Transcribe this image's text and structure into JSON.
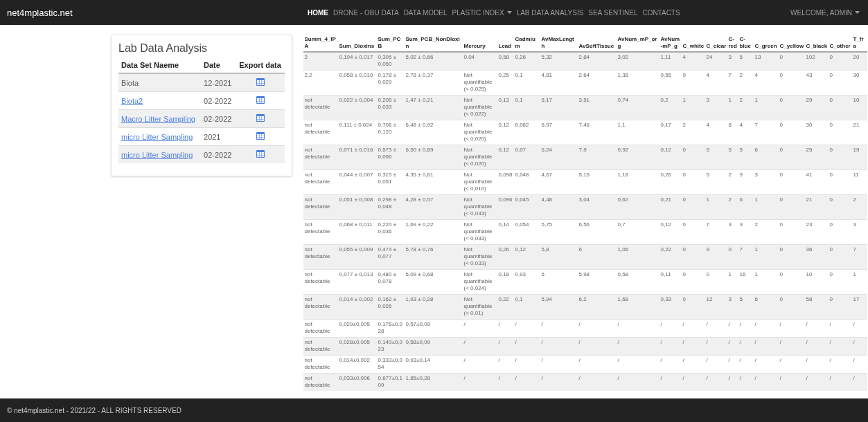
{
  "navbar": {
    "brand": "net4mplastic.net",
    "items": [
      {
        "label": "HOME",
        "selected": true,
        "dropdown": false
      },
      {
        "label": "DRONE - OBU DATA",
        "selected": false,
        "dropdown": false
      },
      {
        "label": "DATA MODEL",
        "selected": false,
        "dropdown": false
      },
      {
        "label": "PLASTIC INDEX",
        "selected": false,
        "dropdown": true
      },
      {
        "label": "LAB DATA ANALYSIS",
        "selected": false,
        "dropdown": false
      },
      {
        "label": "SEA SENTINEL",
        "selected": false,
        "dropdown": false
      },
      {
        "label": "CONTACTS",
        "selected": false,
        "dropdown": false
      }
    ],
    "user_menu": {
      "label": "WELCOME, ADMIN",
      "dropdown": true
    }
  },
  "datasets_panel": {
    "title": "Lab Data Analysis",
    "columns": [
      "Data Set Naeme",
      "Date",
      "Export data"
    ],
    "rows": [
      {
        "name": "Biota",
        "link": false,
        "date": "12-2021"
      },
      {
        "name": "Biota2",
        "link": true,
        "date": "02-2022"
      },
      {
        "name": "Macro Litter Sampling",
        "link": true,
        "date": "02-2022"
      },
      {
        "name": "micro Litter Sampling",
        "link": true,
        "date": "2021"
      },
      {
        "name": "micro Litter Sampling",
        "link": true,
        "date": "02-2022"
      }
    ]
  },
  "data_table": {
    "columns": [
      "Summ_4_IPA",
      "Sum_Dioxins",
      "Sum_PCB",
      "Sum_PCB_NonDioxin",
      "Mercury",
      "Lead",
      "Cadmium",
      "AvMaxLength",
      "AvSoftTissue",
      "AvNum_mP_org",
      "AvNum-mP_g",
      "C_white",
      "C_clear",
      "C-red",
      "C-blue",
      "C_green",
      "C_yellow",
      "C_black",
      "C_other",
      "T_fra"
    ],
    "rows": [
      [
        "2",
        "0,104 ± 0,017",
        "0,305 ± 0,050",
        "5,02 ± 0,66",
        "0,04",
        "0,58",
        "0,26",
        "5,32",
        "2,84",
        "3,02",
        "1,11",
        "4",
        "24",
        "3",
        "5",
        "13",
        "0",
        "102",
        "0",
        "20"
      ],
      [
        "2,2",
        "0,058 ± 0,010",
        "0,178 ± 0,029",
        "2,78 ± 0,37",
        "Not quantifiable (< 0,025)",
        "0,25",
        "0,1",
        "4,81",
        "2,64",
        "1,38",
        "0,55",
        "9",
        "4",
        "7",
        "2",
        "4",
        "0",
        "43",
        "0",
        "30"
      ],
      [
        "not detectable",
        "0,022 ± 0,004",
        "0,205 ± 0,033",
        "1,47 ± 0,21",
        "Not quantifiable (< 0,022)",
        "0,13",
        "0,1",
        "5,17",
        "3,51",
        "0,74",
        "0,2",
        "1",
        "3",
        "1",
        "2",
        "1",
        "0",
        "29",
        "0",
        "10"
      ],
      [
        "not detectable",
        "0,111 ± 0,024",
        "0,706 ± 0,120",
        "6,48 ± 0,92",
        "Not quantifiable (< 0,020)",
        "0,12",
        "0,062",
        "6,97",
        "7,46",
        "1,1",
        "0,17",
        "2",
        "4",
        "8",
        "4",
        "7",
        "0",
        "30",
        "0",
        "21"
      ],
      [
        "not detectable",
        "0,071 ± 0,016",
        "0,573 ± 0,096",
        "6,50 ± 0,89",
        "Not quantifiable (< 0,020)",
        "0,12",
        "0,07",
        "6,24",
        "7,9",
        "0,92",
        "0,12",
        "0",
        "5",
        "5",
        "5",
        "6",
        "0",
        "25",
        "0",
        "19"
      ],
      [
        "not detectable",
        "0,044 ± 0,007",
        "0,315 ± 0,051",
        "4,35 ± 0,61",
        "Not quantifiable (< 0,010)",
        "0,098",
        "0,048",
        "4,67",
        "5,15",
        "1,18",
        "0,26",
        "0",
        "5",
        "2",
        "9",
        "3",
        "0",
        "41",
        "0",
        "11"
      ],
      [
        "not detectable",
        "0,051 ± 0,008",
        "0,298 ± 0,048",
        "4,28 ± 0,57",
        "Not quantifiable (< 0,033)",
        "0,096",
        "0,045",
        "4,48",
        "3,04",
        "0,62",
        "0,21",
        "0",
        "1",
        "2",
        "6",
        "1",
        "0",
        "21",
        "0",
        "2"
      ],
      [
        "not detectable",
        "0,068 ± 0,011",
        "0,220 ± 0,036",
        "1,69 ± 0,22",
        "Not quantifiable (< 0,033)",
        "0,14",
        "0,054",
        "5,75",
        "6,56",
        "0,7",
        "0,12",
        "0",
        "7",
        "3",
        "3",
        "2",
        "0",
        "23",
        "0",
        "3"
      ],
      [
        "not detectable",
        "0,055 ± 0,009",
        "0,474 ± 0,077",
        "5,78 ± 0,76",
        "Not quantifiable (< 0,033)",
        "0,26",
        "0,12",
        "5,8",
        "6",
        "1,06",
        "0,22",
        "0",
        "9",
        "0",
        "7",
        "1",
        "0",
        "36",
        "0",
        "7"
      ],
      [
        "not detectable",
        "0,077 ± 0,013",
        "0,480 ± 0,078",
        "5,09 ± 0,68",
        "Not quantifiable (< 0,024)",
        "0,18",
        "0,93",
        "6",
        "5,98",
        "0,58",
        "0,11",
        "0",
        "0",
        "1",
        "16",
        "1",
        "0",
        "10",
        "0",
        "1"
      ],
      [
        "not detectable",
        "0,014 ± 0,002",
        "0,162 ± 0,026",
        "1,93 ± 0,28",
        "Not quantifiable (< 0,01)",
        "0,22",
        "0,1",
        "5,94",
        "6,2",
        "1,68",
        "0,33",
        "0",
        "12",
        "3",
        "5",
        "6",
        "0",
        "58",
        "0",
        "17"
      ],
      [
        "not detectable",
        "0,029±0,005",
        "0,176±0,028",
        "0,57±0,09",
        "/",
        "/",
        "/",
        "/",
        "/",
        "/",
        "/",
        "/",
        "/",
        "/",
        "/",
        "/",
        "/",
        "/",
        "/",
        "/"
      ],
      [
        "not detectable",
        "0,028±0,005",
        "0,140±0,023",
        "0,58±0,09",
        "/",
        "/",
        "/",
        "/",
        "/",
        "/",
        "/",
        "/",
        "/",
        "/",
        "/",
        "/",
        "/",
        "/",
        "/",
        "/"
      ],
      [
        "not detectable",
        "0,014±0,002",
        "0,333±0,054",
        "0,93±0,14",
        "/",
        "/",
        "/",
        "/",
        "/",
        "/",
        "/",
        "/",
        "/",
        "/",
        "/",
        "/",
        "/",
        "/",
        "/",
        "/"
      ],
      [
        "not detectable",
        "0,033±0,006",
        "0,677±0,109",
        "1,85±0,28",
        "/",
        "/",
        "/",
        "/",
        "/",
        "/",
        "/",
        "/",
        "/",
        "/",
        "/",
        "/",
        "/",
        "/",
        "/",
        "/"
      ]
    ]
  },
  "footer": {
    "text": "© net4mplastic.net - 2021/22 - ALL RIGHTS RESERVED"
  }
}
